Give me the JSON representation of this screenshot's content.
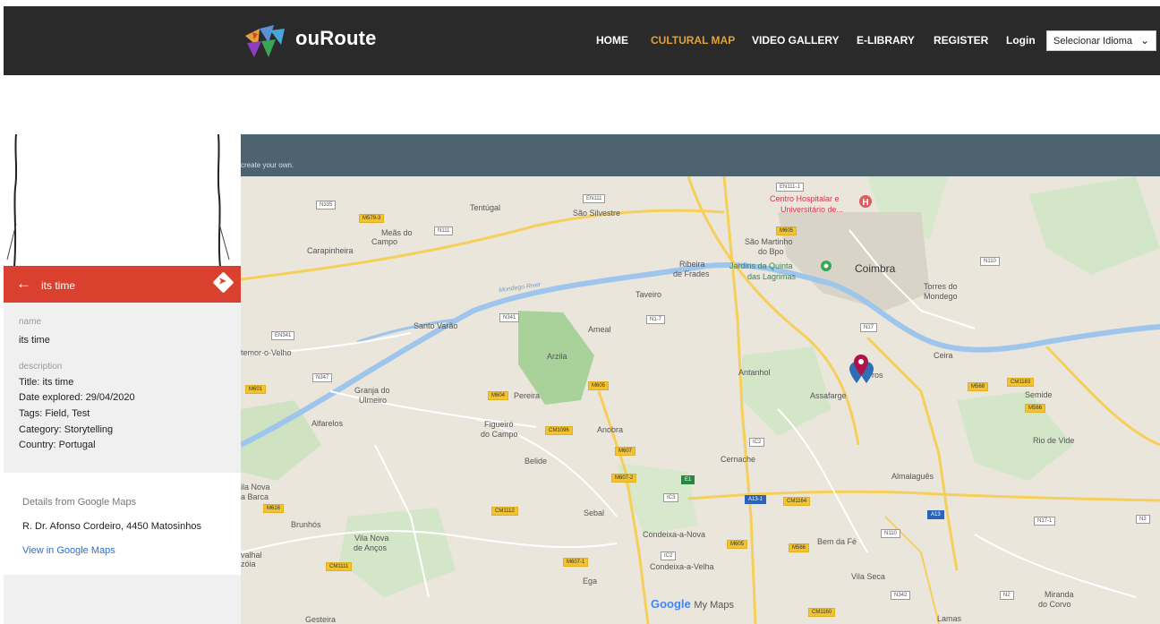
{
  "header": {
    "logo_text": "ouRoute",
    "nav": [
      {
        "label": "HOME",
        "active": false
      },
      {
        "label": "CULTURAL MAP",
        "active": true
      },
      {
        "label": "VIDEO GALLERY",
        "active": false
      },
      {
        "label": "E-LIBRARY",
        "active": false
      },
      {
        "label": "REGISTER",
        "active": false
      },
      {
        "label": "Login",
        "active": false
      }
    ],
    "language_select": "Selecionar Idioma",
    "colors": {
      "bar": "#2a2a2a",
      "active": "#e0a23b"
    }
  },
  "info_panel": {
    "title": "its time",
    "name_label": "name",
    "name_value": "its time",
    "description_label": "description",
    "description_lines": [
      "Title: its time",
      "Date explored: 29/04/2020",
      "Tags: Field, Test",
      "Category: Storytelling",
      "Country: Portugal"
    ],
    "google_details_title": "Details from Google Maps",
    "google_address": "R. Dr. Afonso Cordeiro, 4450 Matosinhos",
    "google_link": "View in Google Maps",
    "colors": {
      "header": "#d9402d",
      "link": "#2a6fd1"
    }
  },
  "map": {
    "banner_text": "create your own.",
    "attribution": {
      "google": "Google",
      "product": "My Maps"
    },
    "places": [
      {
        "name": "Coimbra",
        "big": true
      },
      {
        "name": "Tentúgal"
      },
      {
        "name": "São Silvestre"
      },
      {
        "name": "Meãs do"
      },
      {
        "name": "Campo"
      },
      {
        "name": "Carapinheira"
      },
      {
        "name": "Centro Hospitalar e",
        "style": "red"
      },
      {
        "name": "Universitário de...",
        "style": "red"
      },
      {
        "name": "São Martinho"
      },
      {
        "name": "do Bpo"
      },
      {
        "name": "Jardins da Quinta",
        "style": "green"
      },
      {
        "name": "das Lagrimas",
        "style": "green"
      },
      {
        "name": "Ribeira"
      },
      {
        "name": "de Frades"
      },
      {
        "name": "Taveiro"
      },
      {
        "name": "Torres do"
      },
      {
        "name": "Mondego"
      },
      {
        "name": "Santo Varão"
      },
      {
        "name": "Ameal"
      },
      {
        "name": "Arzila"
      },
      {
        "name": "Antanhol"
      },
      {
        "name": "Assafarge"
      },
      {
        "name": "Ceira"
      },
      {
        "name": "Semide"
      },
      {
        "name": "Granja do"
      },
      {
        "name": "Ulmeiro"
      },
      {
        "name": "Pereira"
      },
      {
        "name": "Alfarelos"
      },
      {
        "name": "Figueiró"
      },
      {
        "name": "do Campo"
      },
      {
        "name": "Anobra"
      },
      {
        "name": "Belide"
      },
      {
        "name": "Cernache"
      },
      {
        "name": "Rio de Vide"
      },
      {
        "name": "Almalaguês"
      },
      {
        "name": "Sebal"
      },
      {
        "name": "Brunhós"
      },
      {
        "name": "Vila Nova"
      },
      {
        "name": "de Anços"
      },
      {
        "name": "Condeixa-a-Nova"
      },
      {
        "name": "Condeixa-a-Velha"
      },
      {
        "name": "Bem da Fé"
      },
      {
        "name": "Vila Seca"
      },
      {
        "name": "Ega"
      },
      {
        "name": "Miranda"
      },
      {
        "name": "do Corvo"
      },
      {
        "name": "Lamas"
      },
      {
        "name": "Gesteira"
      },
      {
        "name": "temor-o-Velho"
      },
      {
        "name": "ila Nova"
      },
      {
        "name": "a Barca"
      },
      {
        "name": "valhal"
      },
      {
        "name": "zóia"
      },
      {
        "name": "ros"
      },
      {
        "name": "Mondego River"
      }
    ],
    "road_badges": [
      "N335",
      "M579-3",
      "EN111",
      "N111",
      "EN111-1",
      "M605",
      "N110",
      "N341",
      "N17",
      "N347",
      "M604",
      "N1-7",
      "EN341",
      "M605",
      "M607",
      "M607-2",
      "M607-1",
      "IC3",
      "IC2",
      "A13-1",
      "A13",
      "CM1164",
      "CM1112",
      "M616",
      "CM1111",
      "M605",
      "M566",
      "N17-1",
      "CM1183",
      "M568",
      "N342",
      "M601",
      "E1",
      "IC2",
      "CM1096",
      "CM1160",
      "M566",
      "N110",
      "N2",
      "N3"
    ]
  }
}
